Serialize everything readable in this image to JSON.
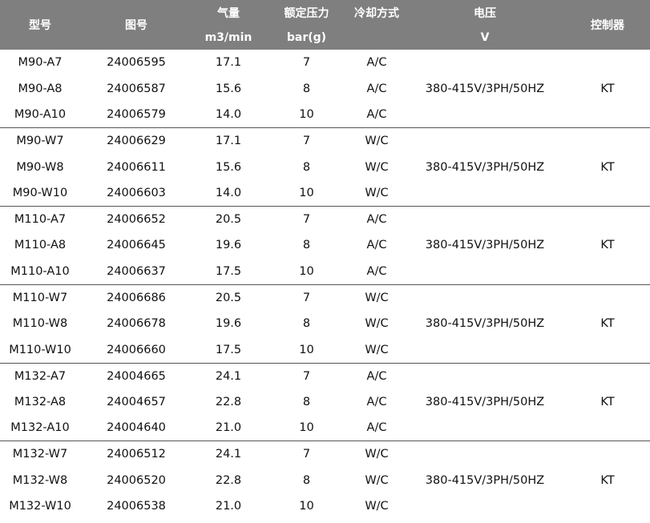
{
  "headers": {
    "model": "型号",
    "drawing_no": "图号",
    "airflow_top": "气量",
    "airflow_unit": "m3/min",
    "pressure_top": "额定压力",
    "pressure_unit": "bar(g)",
    "cooling": "冷却方式",
    "voltage_top": "电压",
    "voltage_unit": "V",
    "controller": "控制器"
  },
  "groups": [
    {
      "voltage": "380-415V/3PH/50HZ",
      "controller": "KT",
      "rows": [
        {
          "model": "M90-A7",
          "drawing": "24006595",
          "airflow": "17.1",
          "pressure": "7",
          "cooling": "A/C"
        },
        {
          "model": "M90-A8",
          "drawing": "24006587",
          "airflow": "15.6",
          "pressure": "8",
          "cooling": "A/C"
        },
        {
          "model": "M90-A10",
          "drawing": "24006579",
          "airflow": "14.0",
          "pressure": "10",
          "cooling": "A/C"
        }
      ]
    },
    {
      "voltage": "380-415V/3PH/50HZ",
      "controller": "KT",
      "rows": [
        {
          "model": "M90-W7",
          "drawing": "24006629",
          "airflow": "17.1",
          "pressure": "7",
          "cooling": "W/C"
        },
        {
          "model": "M90-W8",
          "drawing": "24006611",
          "airflow": "15.6",
          "pressure": "8",
          "cooling": "W/C"
        },
        {
          "model": "M90-W10",
          "drawing": "24006603",
          "airflow": "14.0",
          "pressure": "10",
          "cooling": "W/C"
        }
      ]
    },
    {
      "voltage": "380-415V/3PH/50HZ",
      "controller": "KT",
      "rows": [
        {
          "model": "M110-A7",
          "drawing": "24006652",
          "airflow": "20.5",
          "pressure": "7",
          "cooling": "A/C"
        },
        {
          "model": "M110-A8",
          "drawing": "24006645",
          "airflow": "19.6",
          "pressure": "8",
          "cooling": "A/C"
        },
        {
          "model": "M110-A10",
          "drawing": "24006637",
          "airflow": "17.5",
          "pressure": "10",
          "cooling": "A/C"
        }
      ]
    },
    {
      "voltage": "380-415V/3PH/50HZ",
      "controller": "KT",
      "rows": [
        {
          "model": "M110-W7",
          "drawing": "24006686",
          "airflow": "20.5",
          "pressure": "7",
          "cooling": "W/C"
        },
        {
          "model": "M110-W8",
          "drawing": "24006678",
          "airflow": "19.6",
          "pressure": "8",
          "cooling": "W/C"
        },
        {
          "model": "M110-W10",
          "drawing": "24006660",
          "airflow": "17.5",
          "pressure": "10",
          "cooling": "W/C"
        }
      ]
    },
    {
      "voltage": "380-415V/3PH/50HZ",
      "controller": "KT",
      "rows": [
        {
          "model": "M132-A7",
          "drawing": "24004665",
          "airflow": "24.1",
          "pressure": "7",
          "cooling": "A/C"
        },
        {
          "model": "M132-A8",
          "drawing": "24004657",
          "airflow": "22.8",
          "pressure": "8",
          "cooling": "A/C"
        },
        {
          "model": "M132-A10",
          "drawing": "24004640",
          "airflow": "21.0",
          "pressure": "10",
          "cooling": "A/C"
        }
      ]
    },
    {
      "voltage": "380-415V/3PH/50HZ",
      "controller": "KT",
      "rows": [
        {
          "model": "M132-W7",
          "drawing": "24006512",
          "airflow": "24.1",
          "pressure": "7",
          "cooling": "W/C"
        },
        {
          "model": "M132-W8",
          "drawing": "24006520",
          "airflow": "22.8",
          "pressure": "8",
          "cooling": "W/C"
        },
        {
          "model": "M132-W10",
          "drawing": "24006538",
          "airflow": "21.0",
          "pressure": "10",
          "cooling": "W/C"
        }
      ]
    }
  ]
}
